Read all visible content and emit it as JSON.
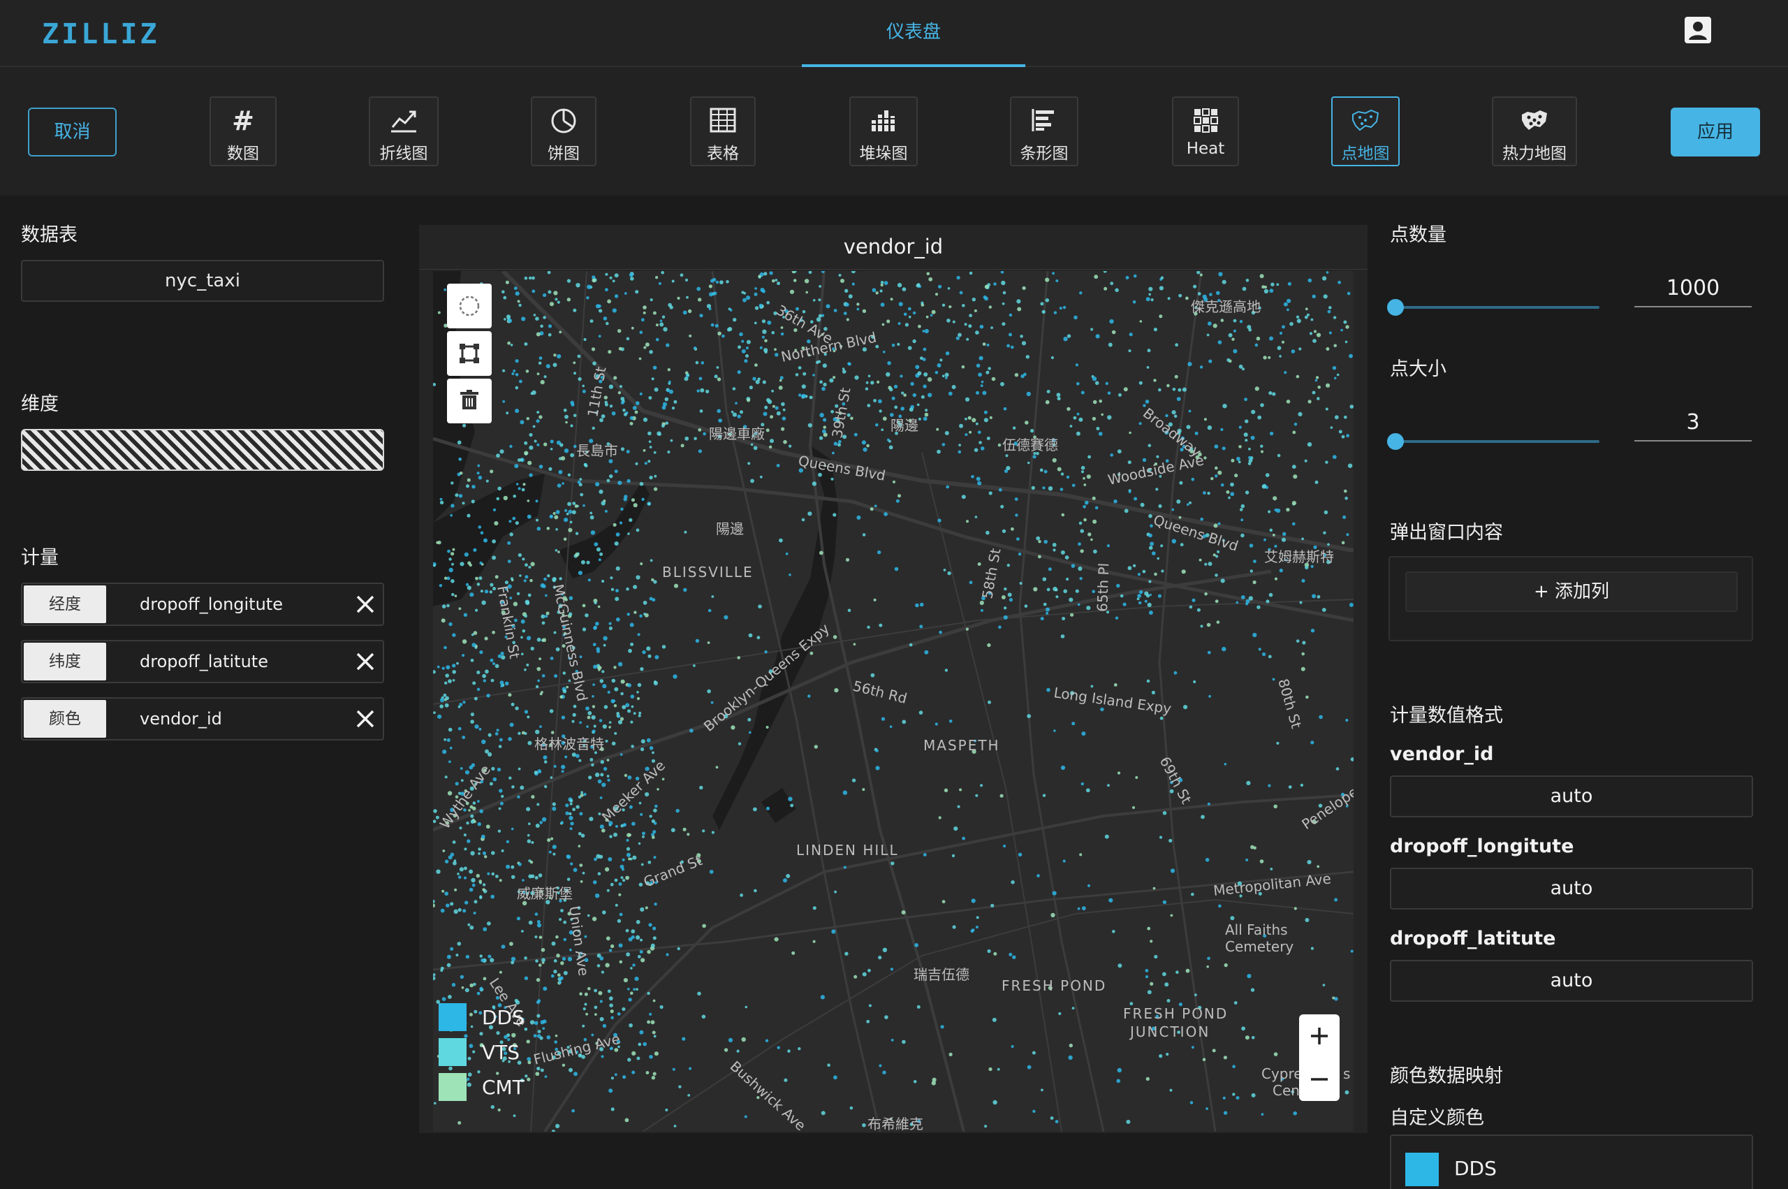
{
  "header": {
    "logo": "ZILLIZ",
    "nav_tab": "仪表盘",
    "user_icon": "account-icon"
  },
  "toolbar": {
    "cancel_label": "取消",
    "apply_label": "应用",
    "chart_types": [
      {
        "label": "数图",
        "icon": "hash-icon"
      },
      {
        "label": "折线图",
        "icon": "line-chart-icon"
      },
      {
        "label": "饼图",
        "icon": "pie-chart-icon"
      },
      {
        "label": "表格",
        "icon": "table-icon"
      },
      {
        "label": "堆垛图",
        "icon": "stacked-bar-icon"
      },
      {
        "label": "条形图",
        "icon": "bar-chart-icon"
      },
      {
        "label": "Heat",
        "icon": "heat-grid-icon"
      },
      {
        "label": "点地图",
        "icon": "point-map-icon",
        "active": true
      },
      {
        "label": "热力地图",
        "icon": "heat-map-icon"
      }
    ]
  },
  "left": {
    "data_table_title": "数据表",
    "data_table_value": "nyc_taxi",
    "dimension_title": "维度",
    "measure_title": "计量",
    "measures": [
      {
        "tag": "经度",
        "value": "dropoff_longitute"
      },
      {
        "tag": "纬度",
        "value": "dropoff_latitute"
      },
      {
        "tag": "颜色",
        "value": "vendor_id"
      }
    ]
  },
  "map": {
    "title": "vendor_id",
    "labels": {
      "l01": "36th Ave",
      "l02": "Northern Blvd",
      "l03": "傑克遜高地",
      "l04": "11th St",
      "l05": "39th St",
      "l06": "陽邊車廠",
      "l07": "陽邊",
      "l08": "長島市",
      "l09": "Queens Blvd",
      "l10": "伍德賽德",
      "l11": "Broadway",
      "l12": "Woodside Ave",
      "l13": "陽邊",
      "l14": "Queens Blvd",
      "l15": "艾姆赫斯特",
      "l16": "BLISSVILLE",
      "l17": "58th St",
      "l18": "65th Pl",
      "l19": "Franklin St",
      "l20": "McGuinness Blvd",
      "l21": "Brooklyn-Queens Expy",
      "l22": "56th Rd",
      "l23": "Long Island Expy",
      "l24": "80th St",
      "l25": "格林波音特",
      "l26": "MASPETH",
      "l27": "69th St",
      "l28": "Meeker Ave",
      "l29": "Wythe Ave",
      "l30": "Penelope",
      "l31": "LINDEN HILL",
      "l32": "威廉斯堡",
      "l33": "Grand St",
      "l34": "Metropolitan Ave",
      "l35": "All Faiths",
      "l36": "Cemetery",
      "l37": "Union Ave",
      "l38": "瑞吉伍德",
      "l39": "FRESH POND",
      "l40": "FRESH POND",
      "l41": "JUNCTION",
      "l42": "Lee Ave",
      "l43": "Flushing Ave",
      "l44": "Bushwick Ave",
      "l45": "布希維克",
      "l46": "Cypre",
      "l47": "Cen",
      "l48": "s"
    },
    "legend": [
      {
        "name": "DDS",
        "color": "#2db7e6"
      },
      {
        "name": "VTS",
        "color": "#5fd8df"
      },
      {
        "name": "CMT",
        "color": "#9ee3b8"
      }
    ],
    "draw_controls": [
      "circle-select-icon",
      "polygon-select-icon",
      "trash-icon"
    ],
    "zoom_controls": [
      "zoom-in-icon",
      "zoom-out-icon"
    ]
  },
  "right": {
    "point_count_title": "点数量",
    "point_count_value": "1000",
    "point_count_fraction": 0.0,
    "point_size_title": "点大小",
    "point_size_value": "3",
    "point_size_fraction": 0.0,
    "popup_title": "弹出窗口内容",
    "add_column_label": "+ 添加列",
    "format_title": "计量数值格式",
    "formats": [
      {
        "name": "vendor_id",
        "value": "auto"
      },
      {
        "name": "dropoff_longitute",
        "value": "auto"
      },
      {
        "name": "dropoff_latitute",
        "value": "auto"
      }
    ],
    "color_mapping_title": "颜色数据映射",
    "custom_color_title": "自定义颜色",
    "custom_color": {
      "name": "DDS",
      "color": "#2db7e6"
    }
  }
}
